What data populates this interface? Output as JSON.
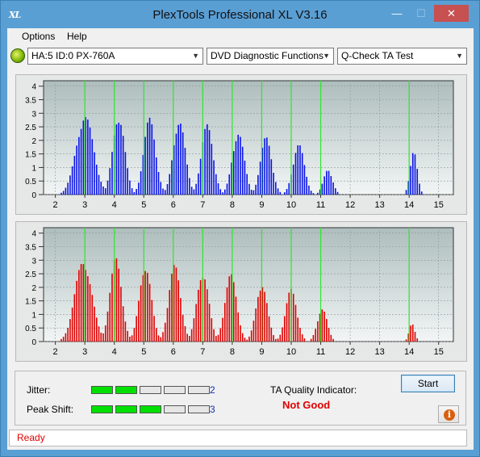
{
  "window": {
    "title": "PlexTools Professional XL V3.16",
    "app_icon_text": "XL",
    "minimize_glyph": "—",
    "maximize_glyph": "☐",
    "close_glyph": "✕"
  },
  "menu": {
    "options": "Options",
    "help": "Help"
  },
  "toolbar": {
    "drive": "HA:5 ID:0  PX-760A",
    "function": "DVD Diagnostic Functions",
    "test": "Q-Check TA Test"
  },
  "results": {
    "jitter_label": "Jitter:",
    "jitter_value": "2",
    "jitter_level": 2,
    "peak_label": "Peak Shift:",
    "peak_value": "3",
    "peak_level": 3,
    "segments": 5,
    "ta_label": "TA Quality Indicator:",
    "ta_value": "Not Good",
    "start_label": "Start"
  },
  "status": {
    "text": "Ready"
  },
  "colors": {
    "top_bars": "#0a14e6",
    "bottom_bars": "#e00000",
    "marker_line": "#2ee62e",
    "status_text": "#e00000",
    "ta_value": "#e00000"
  },
  "chart_data": [
    {
      "type": "bar",
      "series_color": "#0a14e6",
      "x_ticks": [
        2,
        3,
        4,
        5,
        6,
        7,
        8,
        9,
        10,
        11,
        12,
        13,
        14,
        15
      ],
      "y_ticks": [
        "0",
        "0.5",
        "1",
        "1.5",
        "2",
        "2.5",
        "3",
        "3.5",
        "4"
      ],
      "xlim": [
        1.6,
        15.5
      ],
      "ylim": [
        0,
        4.2
      ],
      "markers": [
        3,
        4,
        5,
        6,
        7,
        8,
        9,
        10,
        11,
        14
      ],
      "peaks": [
        {
          "center": 3.0,
          "height": 2.95,
          "width": 0.62
        },
        {
          "center": 4.15,
          "height": 3.0,
          "width": 0.42
        },
        {
          "center": 5.2,
          "height": 2.85,
          "width": 0.42
        },
        {
          "center": 6.2,
          "height": 2.85,
          "width": 0.42
        },
        {
          "center": 7.15,
          "height": 2.6,
          "width": 0.42
        },
        {
          "center": 8.2,
          "height": 2.35,
          "width": 0.42
        },
        {
          "center": 9.15,
          "height": 2.15,
          "width": 0.4
        },
        {
          "center": 10.25,
          "height": 1.9,
          "width": 0.4
        },
        {
          "center": 11.25,
          "height": 0.95,
          "width": 0.32
        },
        {
          "center": 14.15,
          "height": 1.65,
          "width": 0.25
        }
      ],
      "range": [
        [
          2.05,
          11.7
        ],
        [
          13.75,
          14.55
        ]
      ]
    },
    {
      "type": "bar",
      "series_color": "#e00000",
      "x_ticks": [
        2,
        3,
        4,
        5,
        6,
        7,
        8,
        9,
        10,
        11,
        12,
        13,
        14,
        15
      ],
      "y_ticks": [
        "0",
        "0.5",
        "1",
        "1.5",
        "2",
        "2.5",
        "3",
        "3.5",
        "4"
      ],
      "xlim": [
        1.6,
        15.5
      ],
      "ylim": [
        0,
        4.2
      ],
      "markers": [
        3,
        4,
        5,
        6,
        7,
        8,
        9,
        10,
        11,
        14
      ],
      "peaks": [
        {
          "center": 2.95,
          "height": 3.05,
          "width": 0.6
        },
        {
          "center": 4.05,
          "height": 3.1,
          "width": 0.42
        },
        {
          "center": 5.05,
          "height": 2.9,
          "width": 0.42
        },
        {
          "center": 6.05,
          "height": 2.85,
          "width": 0.42
        },
        {
          "center": 7.0,
          "height": 2.65,
          "width": 0.42
        },
        {
          "center": 7.95,
          "height": 2.5,
          "width": 0.42
        },
        {
          "center": 9.0,
          "height": 2.2,
          "width": 0.4
        },
        {
          "center": 10.0,
          "height": 1.95,
          "width": 0.4
        },
        {
          "center": 11.05,
          "height": 1.25,
          "width": 0.35
        },
        {
          "center": 14.1,
          "height": 0.7,
          "width": 0.2
        }
      ],
      "range": [
        [
          1.8,
          11.6
        ],
        [
          13.85,
          14.4
        ]
      ]
    }
  ]
}
